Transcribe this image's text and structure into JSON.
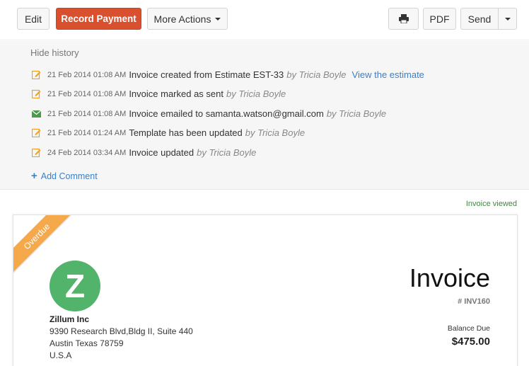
{
  "toolbar": {
    "edit_label": "Edit",
    "record_payment_label": "Record Payment",
    "more_actions_label": "More Actions",
    "pdf_label": "PDF",
    "send_label": "Send",
    "print_icon": "printer-icon",
    "record_payment_color": "#d9502f"
  },
  "history": {
    "hide_label": "Hide history",
    "entries": [
      {
        "icon": "edit-icon",
        "timestamp": "21 Feb 2014 01:08 AM",
        "text": "Invoice created from Estimate EST-33",
        "by": "by Tricia Boyle",
        "link": "View the estimate"
      },
      {
        "icon": "edit-icon",
        "timestamp": "21 Feb 2014 01:08 AM",
        "text": "Invoice marked as sent",
        "by": "by Tricia Boyle"
      },
      {
        "icon": "envelope-icon",
        "timestamp": "21 Feb 2014 01:08 AM",
        "text": "Invoice emailed to samanta.watson@gmail.com",
        "by": "by Tricia Boyle"
      },
      {
        "icon": "edit-icon",
        "timestamp": "21 Feb 2014 01:24 AM",
        "text": "Template has been updated",
        "by": "by Tricia Boyle"
      },
      {
        "icon": "edit-icon",
        "timestamp": "24 Feb 2014 03:34 AM",
        "text": "Invoice updated",
        "by": "by Tricia Boyle"
      }
    ],
    "add_comment_label": "Add Comment",
    "link_color": "#3b7fc4"
  },
  "status": {
    "viewed_label": "Invoice viewed"
  },
  "invoice": {
    "ribbon_label": "Overdue",
    "ribbon_color": "#f5a94a",
    "logo_letter": "Z",
    "logo_color": "#52b36b",
    "company_name": "Zillum Inc",
    "address_line1": "9390 Research Blvd,Bldg II, Suite 440",
    "address_line2": "Austin Texas 78759",
    "address_line3": "U.S.A",
    "title": "Invoice",
    "number": "# INV160",
    "balance_label": "Balance Due",
    "balance_value": "$475.00"
  }
}
